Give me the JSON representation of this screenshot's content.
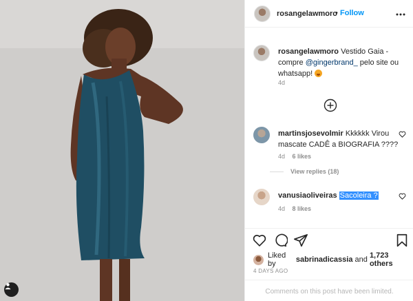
{
  "header": {
    "username": "rosangelawmoro",
    "separator": "•",
    "follow_label": "Follow",
    "more_label": "•••"
  },
  "caption": {
    "username": "rosangelawmoro",
    "text_before": "Vestido Gaia - compre ",
    "mention": "@gingerbrand_",
    "text_after": " pelo site ou whatsapp! ",
    "time": "4d"
  },
  "comments": [
    {
      "username": "martinsjosevolmir",
      "text": "Kkkkkk Virou mascate CADÊ a BIOGRAFIA ????",
      "time": "4d",
      "likes": "6 likes",
      "view_replies": "View replies (18)"
    },
    {
      "username": "vanusiaoliveiras",
      "text": "Sacoleira ?",
      "time": "4d",
      "likes": "8 likes"
    }
  ],
  "actions": {
    "liked_prefix": "Liked by ",
    "liked_user": "sabrinadicassia",
    "liked_mid": " and ",
    "liked_count": "1,723 others",
    "time_ago": "4 DAYS AGO",
    "comments_limited": "Comments on this post have been limited."
  },
  "icons": {
    "heart": "heart-icon",
    "comment": "comment-icon",
    "share": "paper-plane-icon",
    "save": "bookmark-icon",
    "more": "more-icon",
    "add": "plus-circle-icon",
    "user_tag": "user-icon"
  },
  "colors": {
    "link_blue": "#0095f6",
    "mention": "#00376b",
    "dress": "#1f4e63",
    "selection": "#3390ff"
  }
}
